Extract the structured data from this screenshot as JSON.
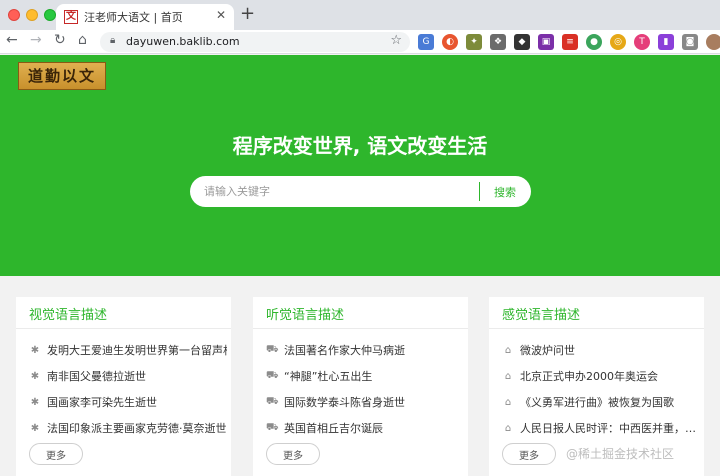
{
  "browser": {
    "tab_title": "汪老师大语文 | 首页",
    "tab_favicon": "文",
    "url": "dayuwen.baklib.com"
  },
  "header": {
    "logo_text": "道勤以文"
  },
  "hero": {
    "title": "程序改变世界, 语文改变生活",
    "search_placeholder": "请输入关键字",
    "search_button": "搜索"
  },
  "cards": [
    {
      "title": "视觉语言描述",
      "items": [
        "发明大王爱迪生发明世界第一台留声机",
        "南非国父曼德拉逝世",
        "国画家李可染先生逝世",
        "法国印象派主要画家克劳德·莫奈逝世"
      ],
      "more": "更多"
    },
    {
      "title": "听觉语言描述",
      "items": [
        "法国著名作家大仲马病逝",
        "“神腿”杜心五出生",
        "国际数学泰斗陈省身逝世",
        "英国首相丘吉尔诞辰"
      ],
      "more": "更多"
    },
    {
      "title": "感觉语言描述",
      "items": [
        "微波炉问世",
        "北京正式申办2000年奥运会",
        "《义勇军进行曲》被恢复为国歌",
        "人民日报人民时评：中西医并重，…"
      ],
      "more": "更多"
    }
  ],
  "watermark": "@稀土掘金技术社区",
  "colors": {
    "brand": "#2eb62c"
  },
  "icons": {
    "card1": "gear-icon",
    "card2": "car-icon",
    "card3": "bank-icon"
  }
}
